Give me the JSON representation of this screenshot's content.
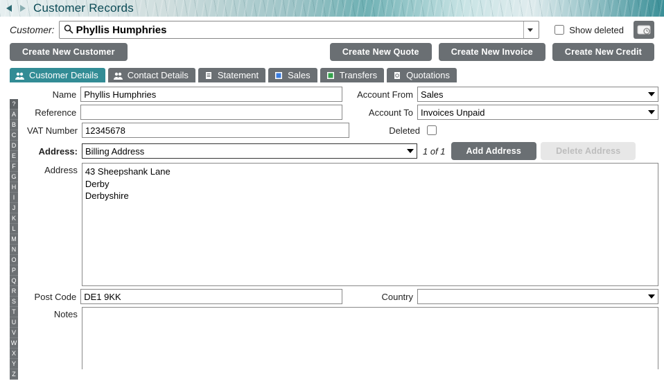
{
  "title": "Customer Records",
  "customer_label": "Customer:",
  "search_value": "Phyllis Humphries",
  "show_deleted_label": "Show deleted",
  "buttons": {
    "create_customer": "Create New Customer",
    "create_quote": "Create New Quote",
    "create_invoice": "Create New Invoice",
    "create_credit": "Create New Credit",
    "add_address": "Add Address",
    "delete_address": "Delete Address"
  },
  "tabs": [
    {
      "label": "Customer Details"
    },
    {
      "label": "Contact Details"
    },
    {
      "label": "Statement"
    },
    {
      "label": "Sales"
    },
    {
      "label": "Transfers"
    },
    {
      "label": "Quotations"
    }
  ],
  "alpha_index": [
    "?",
    "A",
    "B",
    "C",
    "D",
    "E",
    "F",
    "G",
    "H",
    "I",
    "J",
    "K",
    "L",
    "M",
    "N",
    "O",
    "P",
    "Q",
    "R",
    "S",
    "T",
    "U",
    "V",
    "W",
    "X",
    "Y",
    "Z"
  ],
  "form": {
    "name_label": "Name",
    "name_value": "Phyllis Humphries",
    "reference_label": "Reference",
    "reference_value": "",
    "vat_label": "VAT Number",
    "vat_value": "12345678",
    "account_from_label": "Account From",
    "account_from_value": "Sales",
    "account_to_label": "Account To",
    "account_to_value": "Invoices Unpaid",
    "deleted_label": "Deleted",
    "deleted_checked": false,
    "address_picker_label": "Address:",
    "address_picker_value": "Billing Address",
    "address_count": "1 of 1",
    "address_label": "Address",
    "address_value": "43 Sheepshank Lane\nDerby\nDerbyshire",
    "postcode_label": "Post Code",
    "postcode_value": "DE1 9KK",
    "country_label": "Country",
    "country_value": "",
    "notes_label": "Notes",
    "notes_value": ""
  }
}
